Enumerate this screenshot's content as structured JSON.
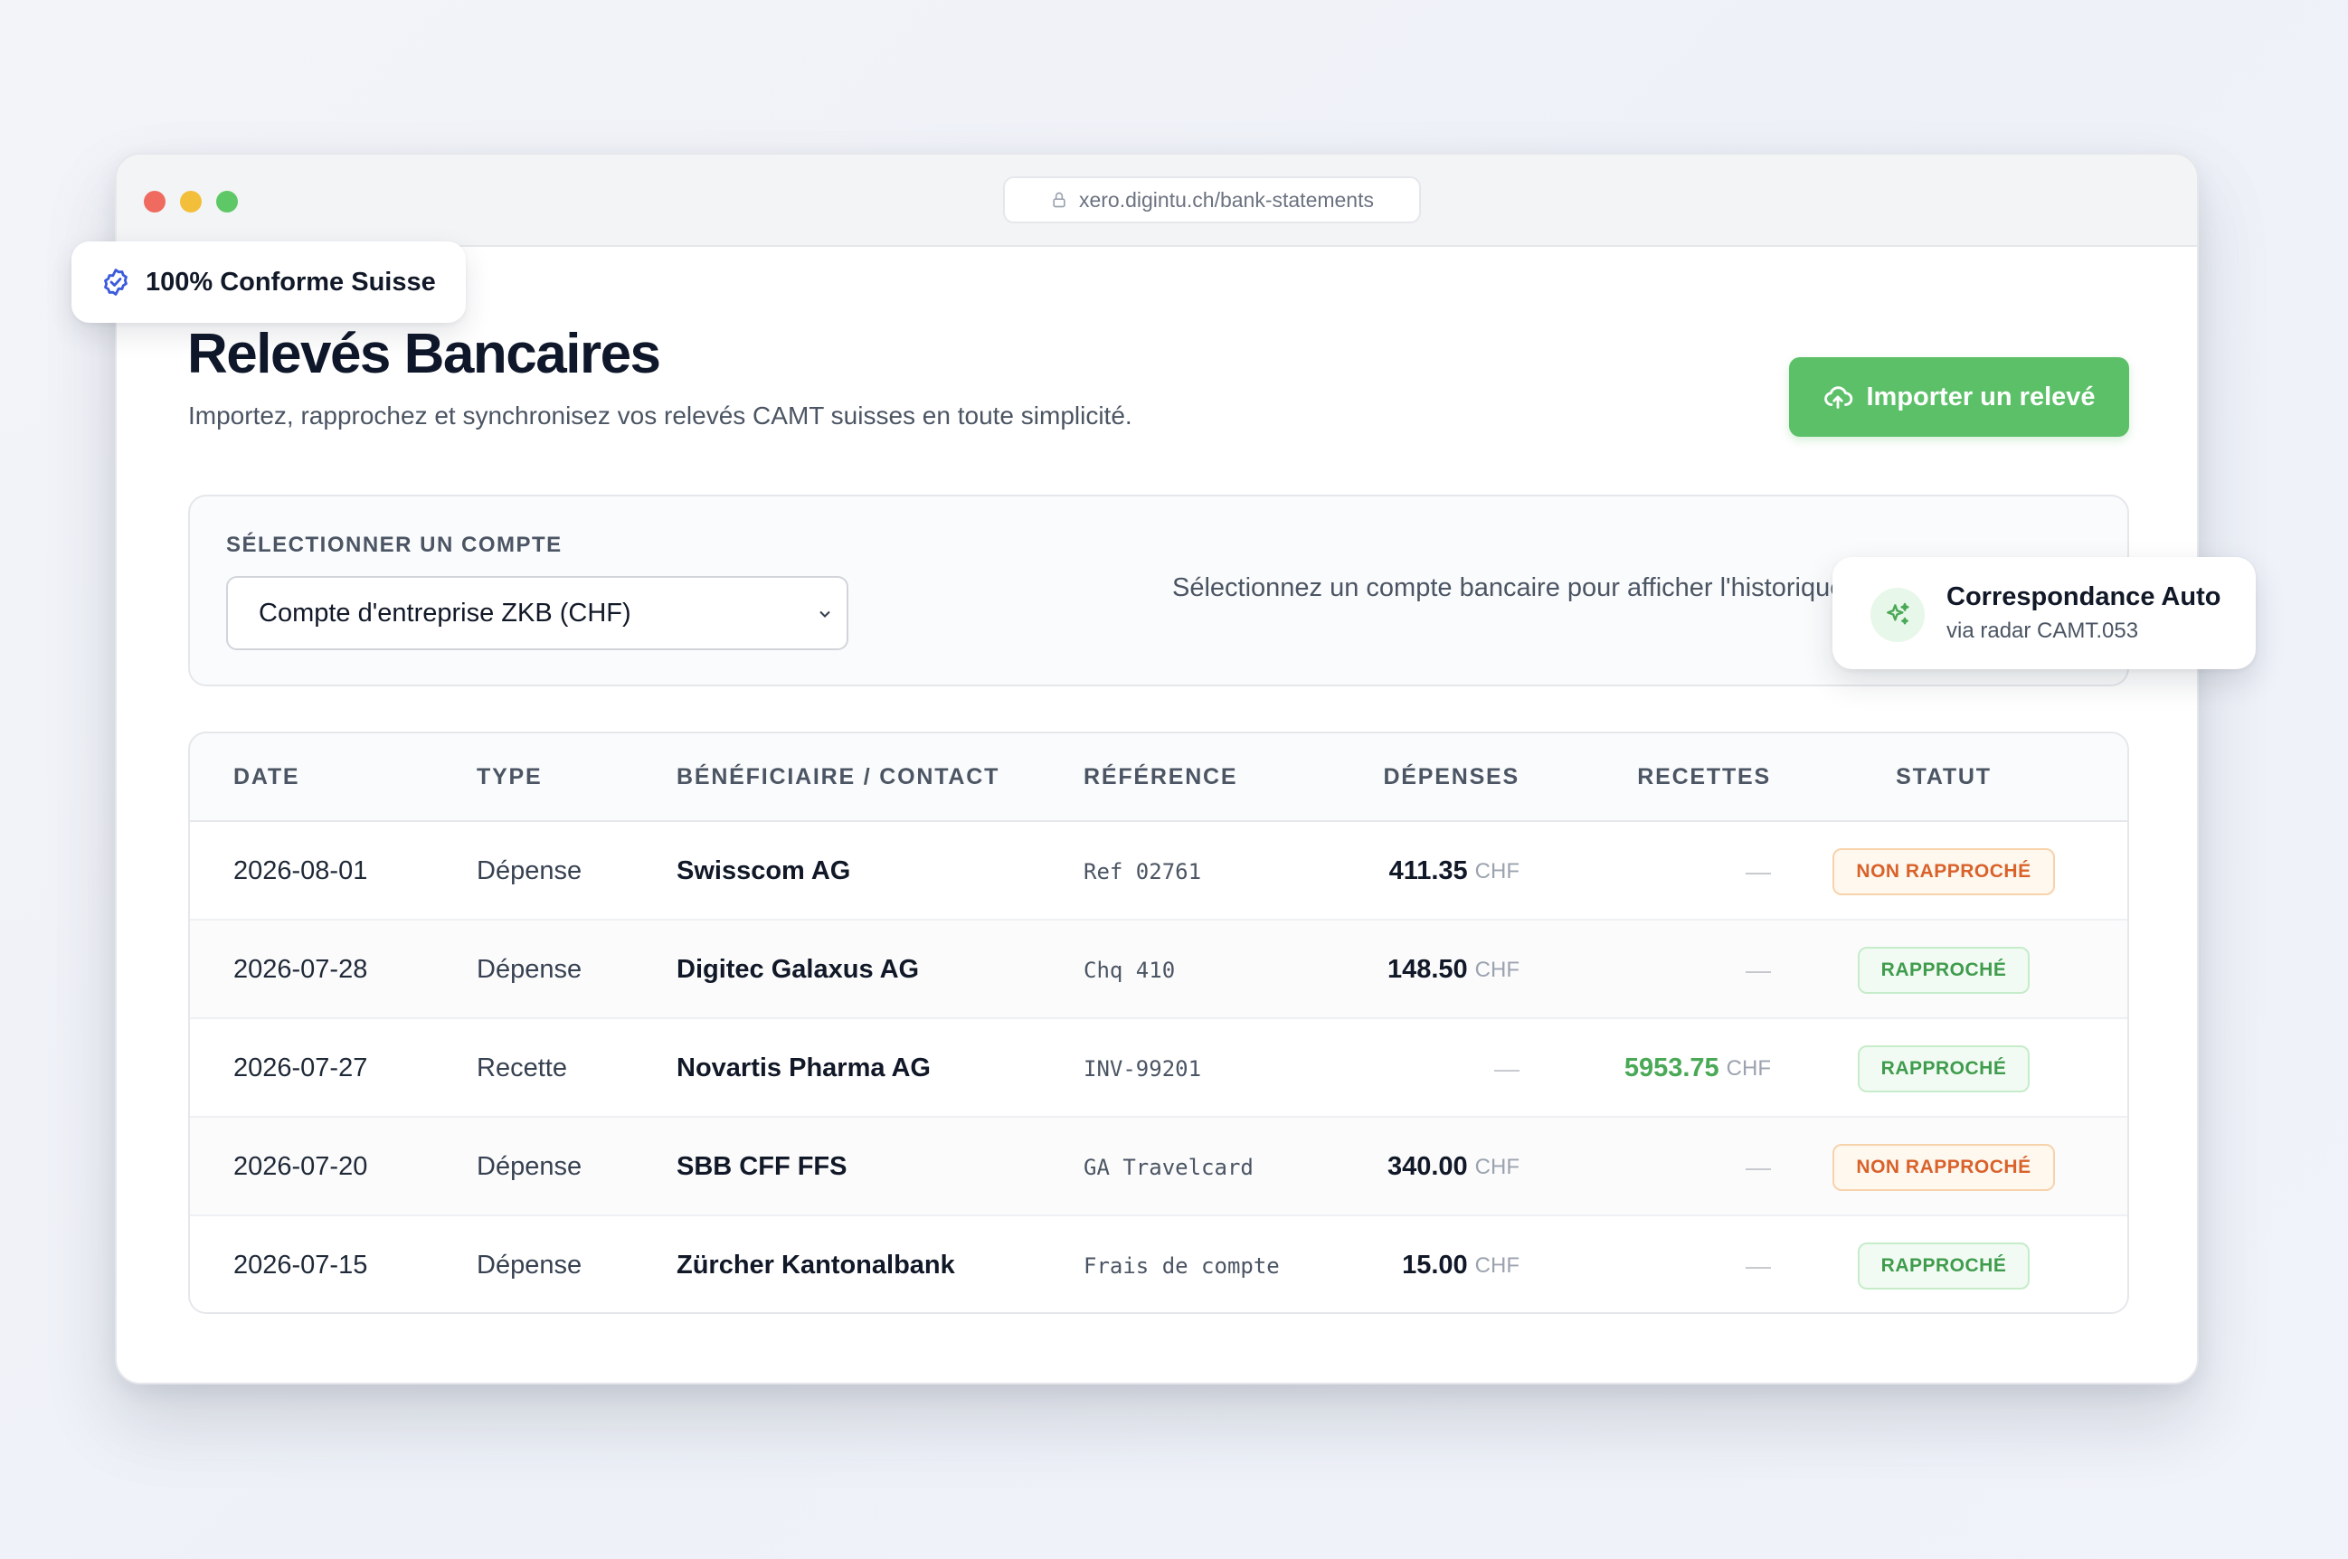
{
  "browser": {
    "url": "xero.digintu.ch/bank-statements"
  },
  "badges": {
    "conform": "100% Conforme Suisse",
    "auto_title": "Correspondance Auto",
    "auto_sub": "via radar CAMT.053"
  },
  "header": {
    "title": "Relevés Bancaires",
    "subtitle": "Importez, rapprochez et synchronisez vos relevés CAMT suisses en toute simplicité.",
    "import_button": "Importer un relevé"
  },
  "account": {
    "label": "SÉLECTIONNER UN COMPTE",
    "selected": "Compte d'entreprise ZKB (CHF)",
    "hint": "Sélectionnez un compte bancaire pour afficher l'historique"
  },
  "table": {
    "columns": [
      "DATE",
      "TYPE",
      "BÉNÉFICIAIRE / CONTACT",
      "RÉFÉRENCE",
      "DÉPENSES",
      "RECETTES",
      "STATUT"
    ],
    "currency": "CHF",
    "empty": "—",
    "rows": [
      {
        "date": "2026-08-01",
        "type": "Dépense",
        "payee": "Swisscom AG",
        "reference": "Ref 02761",
        "expense": "411.35",
        "income": "",
        "status": "NON RAPPROCHÉ"
      },
      {
        "date": "2026-07-28",
        "type": "Dépense",
        "payee": "Digitec Galaxus AG",
        "reference": "Chq 410",
        "expense": "148.50",
        "income": "",
        "status": "RAPPROCHÉ"
      },
      {
        "date": "2026-07-27",
        "type": "Recette",
        "payee": "Novartis Pharma AG",
        "reference": "INV-99201",
        "expense": "",
        "income": "5953.75",
        "status": "RAPPROCHÉ"
      },
      {
        "date": "2026-07-20",
        "type": "Dépense",
        "payee": "SBB CFF FFS",
        "reference": "GA Travelcard",
        "expense": "340.00",
        "income": "",
        "status": "NON RAPPROCHÉ"
      },
      {
        "date": "2026-07-15",
        "type": "Dépense",
        "payee": "Zürcher Kantonalbank",
        "reference": "Frais de compte",
        "expense": "15.00",
        "income": "",
        "status": "RAPPROCHÉ"
      }
    ]
  },
  "colors": {
    "accent_green": "#5cc069",
    "income_green": "#4aa957",
    "pending_orange": "#d9622b",
    "matched_green": "#3f9c4d"
  }
}
